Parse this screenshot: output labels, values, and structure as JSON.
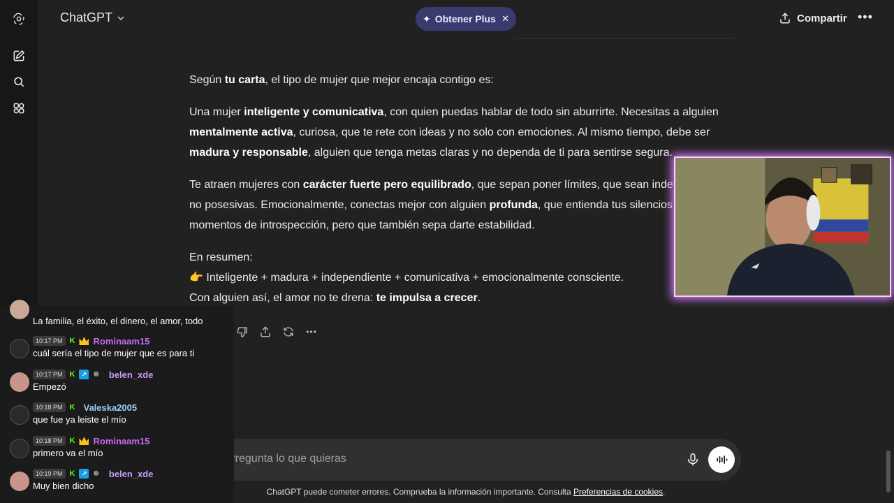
{
  "header": {
    "app_title": "ChatGPT",
    "plus_label": "Obtener Plus",
    "share_label": "Compartir"
  },
  "icons": [
    "chatgpt-logo-icon",
    "new-chat-icon",
    "search-icon",
    "gpts-icon",
    "share-icon",
    "more-icon",
    "copy-icon",
    "thumbs-up-icon",
    "thumbs-down-icon",
    "share-response-icon",
    "regenerate-icon",
    "microphone-icon",
    "voice-mode-icon"
  ],
  "message": {
    "p1": [
      "Según ",
      "tu carta",
      ", el tipo de mujer que mejor encaja contigo es:"
    ],
    "p2": [
      "Una mujer ",
      "inteligente y comunicativa",
      ", con quien puedas hablar de todo sin aburrirte. Necesitas a alguien ",
      "mentalmente activa",
      ", curiosa, que te rete con ideas y no solo con emociones. Al mismo tiempo, debe ser ",
      "madura y responsable",
      ", alguien que tenga metas claras y no dependa de ti para sentirse segura."
    ],
    "p3": [
      "Te atraen mujeres con ",
      "carácter fuerte pero equilibrado",
      ", que sepan poner límites, que sean inde",
      "no posesivas. Emocionalmente, conectas mejor con alguien ",
      "profunda",
      ", que entienda tus silencios",
      "momentos de introspección, pero que también sepa darte estabilidad."
    ],
    "summary_label": "En resumen:",
    "summary_emoji": "👉",
    "summary_line": "Inteligente + madura + independiente + comunicativa + emocionalmente consciente.",
    "closing": [
      "Con alguien así, el amor no te drena: ",
      "te impulsa a crecer",
      "."
    ]
  },
  "composer": {
    "placeholder": "Pregunta lo que quieras"
  },
  "disclaimer": {
    "text": "ChatGPT puede cometer errores. Comprueba la información importante. Consulta ",
    "link": "Preferencias de cookies",
    "end": "."
  },
  "chat": [
    {
      "time": "",
      "user": "",
      "color": "#ffffff",
      "text": "La familia, el éxito, el dinero, el amor, todo",
      "badges": []
    },
    {
      "time": "10:17 PM",
      "user": "Rominaam15",
      "color": "#c86bf0",
      "text": "cuál sería el tipo de mujer que es para ti",
      "badges": [
        "kick",
        "crown"
      ]
    },
    {
      "time": "10:17 PM",
      "user": "belen_xde",
      "color": "#c79bf7",
      "text": "Empezó",
      "badges": [
        "kick",
        "blue",
        "gift"
      ]
    },
    {
      "time": "10:18 PM",
      "user": "Valeska2005",
      "color": "#9ccff7",
      "text": "que fue ya leiste el mío",
      "badges": [
        "kick"
      ]
    },
    {
      "time": "10:18 PM",
      "user": "Rominaam15",
      "color": "#c86bf0",
      "text": "primero va el mío",
      "badges": [
        "kick",
        "crown"
      ]
    },
    {
      "time": "10:19 PM",
      "user": "belen_xde",
      "color": "#c79bf7",
      "text": "Muy bien dicho",
      "badges": [
        "kick",
        "blue",
        "gift"
      ]
    }
  ]
}
